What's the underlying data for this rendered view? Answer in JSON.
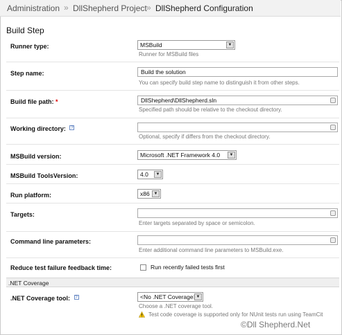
{
  "breadcrumb": {
    "items": [
      "Administration",
      "DllShepherd Project",
      "DllShepherd Configuration"
    ],
    "separator": "»"
  },
  "page_title": "Build Step",
  "fields": {
    "runner_type": {
      "label": "Runner type:",
      "value": "MSBuild",
      "note": "Runner for MSBuild files",
      "icon": "chevron-down-icon"
    },
    "step_name": {
      "label": "Step name:",
      "value": "Build the solution",
      "note": "You can specify build step name to distinguish it from other steps."
    },
    "build_file_path": {
      "label": "Build file path:",
      "required_mark": "*",
      "value": "DllShepherd\\DllShepherd.sln",
      "note": "Specified path should be relative to the checkout directory."
    },
    "working_directory": {
      "label": "Working directory:",
      "help": "?",
      "value": "",
      "note": "Optional, specify if differs from the checkout directory."
    },
    "msbuild_version": {
      "label": "MSBuild version:",
      "value": "Microsoft .NET Framework 4.0"
    },
    "toolsversion": {
      "label": "MSBuild ToolsVersion:",
      "value": "4.0"
    },
    "run_platform": {
      "label": "Run platform:",
      "value": "x86"
    },
    "targets": {
      "label": "Targets:",
      "value": "",
      "note": "Enter targets separated by space or semicolon."
    },
    "cmd_params": {
      "label": "Command line parameters:",
      "value": "",
      "note": "Enter additional command line parameters to MSBuild.exe."
    },
    "reduce_feedback": {
      "label": "Reduce test failure feedback time:",
      "checkbox_label": "Run recently failed tests first",
      "checked": false
    }
  },
  "section": {
    "title": ".NET Coverage"
  },
  "coverage": {
    "label": ".NET Coverage tool:",
    "help": "?",
    "value": "<No .NET Coverage>",
    "note": "Choose a .NET coverage tool.",
    "warning": "Test code coverage is supported only for NUnit tests run using TeamCit",
    "warning_icon": "warning-icon"
  },
  "watermark": "©Dll Shepherd.Net",
  "colors": {
    "header_bg": "#f2f2f2",
    "required": "#dd0000",
    "note_text": "#777777",
    "warning": "#f2c200"
  }
}
